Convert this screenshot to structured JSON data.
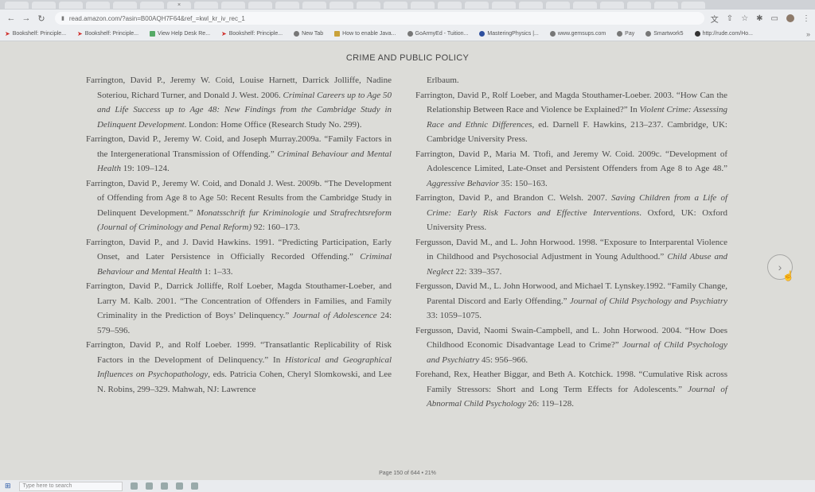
{
  "browser": {
    "tabs": [
      "",
      "",
      "",
      "",
      "",
      "",
      "",
      "",
      "",
      "",
      "",
      "",
      "",
      "",
      "",
      "",
      "",
      "",
      "",
      "",
      "",
      "",
      "",
      "",
      "",
      "",
      "",
      "",
      "",
      ""
    ],
    "close_tab_glyph": "×",
    "nav": {
      "back": "←",
      "forward": "→",
      "reload": "↻"
    },
    "url": "read.amazon.com/?asin=B00AQH7F64&ref_=kwl_kr_iv_rec_1",
    "right_icons": {
      "translate": "文",
      "share": "⇧",
      "star": "☆",
      "extensions": "✱",
      "sidepanel": "▭",
      "menu": "⋮"
    }
  },
  "bookmarks": [
    {
      "label": "Bookshelf: Principle..."
    },
    {
      "label": "Bookshelf: Principle..."
    },
    {
      "label": "View Help Desk Re..."
    },
    {
      "label": "Bookshelf: Principle..."
    },
    {
      "label": "New Tab"
    },
    {
      "label": "How to enable Java..."
    },
    {
      "label": "GoArmyEd - Tuition..."
    },
    {
      "label": "MasteringPhysics |..."
    },
    {
      "label": "www.gemsups.com"
    },
    {
      "label": "Pay"
    },
    {
      "label": "Smartwork5"
    },
    {
      "label": "http://rude.com/Ho..."
    }
  ],
  "bookmarks_more": "»",
  "book": {
    "running_header": "CRIME AND PUBLIC POLICY",
    "left_column": [
      {
        "a": "Farrington, David P., Jeremy W. Coid, Louise Harnett, Darrick Jolliffe, Nadine Soteriou, Richard Turner, and Donald J. West. 2006. ",
        "i": "Criminal Careers up to Age 50 and Life Success up to Age 48: New Findings from the Cambridge Study in Delinquent Development",
        "b": ". London: Home Office (Research Study No. 299)."
      },
      {
        "a": "Farrington, David P., Jeremy W. Coid, and Joseph Murray.2009a. “Family Factors in the Intergenerational Transmission of Offending.” ",
        "i": "Criminal Behaviour and Mental Health",
        "b": " 19: 109–124."
      },
      {
        "a": "Farrington, David P., Jeremy W. Coid, and Donald J. West. 2009b. “The Development of Offending from Age 8 to Age 50: Recent Results from the Cambridge Study in Delinquent Development.” ",
        "i": "Monatsschrift fur Kriminologie und Strafrechtsreform (Journal of Criminology and Penal Reform)",
        "b": " 92: 160–173."
      },
      {
        "a": "Farrington, David P., and J. David Hawkins. 1991. “Predicting Participation, Early Onset, and Later Persistence in Officially Recorded Offending.” ",
        "i": "Criminal Behaviour and Mental Health",
        "b": " 1: 1–33."
      },
      {
        "a": "Farrington, David P., Darrick Jolliffe, Rolf Loeber, Magda Stouthamer-Loeber, and Larry M. Kalb. 2001. “The Concentration of Offenders in Families, and Family Criminality in the Prediction of Boys’ Delinquency.” ",
        "i": "Journal of Adolescence",
        "b": " 24: 579–596."
      },
      {
        "a": "Farrington, David P., and Rolf Loeber. 1999. “Transatlantic Replicability of Risk Factors in the Development of Delinquency.” In ",
        "i": "Historical and Geographical Influences on Psychopathology",
        "b": ", eds. Patricia Cohen, Cheryl Slomkowski, and Lee N. Robins, 299–329. Mahwah, NJ: Lawrence"
      }
    ],
    "right_continuation": "Erlbaum.",
    "right_column": [
      {
        "a": "Farrington, David P., Rolf Loeber, and Magda Stouthamer-Loeber. 2003. “How Can the Relationship Between Race and Violence be Explained?” In ",
        "i": "Violent Crime: Assessing Race and Ethnic Differences",
        "b": ", ed. Darnell F. Hawkins, 213–237. Cambridge, UK: Cambridge University Press."
      },
      {
        "a": "Farrington, David P., Maria M. Ttofi, and Jeremy W. Coid. 2009c. “Development of Adolescence Limited, Late-Onset and Persistent Offenders from Age 8 to Age 48.” ",
        "i": "Aggressive Behavior",
        "b": " 35: 150–163."
      },
      {
        "a": "Farrington, David P., and Brandon C. Welsh. 2007. ",
        "i": "Saving Children from a Life of Crime: Early Risk Factors and Effective Interventions",
        "b": ". Oxford, UK: Oxford University Press."
      },
      {
        "a": "Fergusson, David M., and L. John Horwood. 1998. “Exposure to Interparental Violence in Childhood and Psychosocial Adjustment in Young Adulthood.” ",
        "i": "Child Abuse and Neglect",
        "b": " 22: 339–357."
      },
      {
        "a": "Fergusson, David M., L. John Horwood, and Michael T. Lynskey.1992. “Family Change, Parental Discord and Early Offending.” ",
        "i": "Journal of Child Psychology and Psychiatry",
        "b": " 33: 1059–1075."
      },
      {
        "a": "Fergusson, David, Naomi Swain-Campbell, and L. John Horwood. 2004. “How Does Childhood Economic Disadvantage Lead to Crime?” ",
        "i": "Journal of Child Psychology and Psychiatry",
        "b": " 45: 956–966."
      },
      {
        "a": "Forehand, Rex, Heather Biggar, and Beth A. Kotchick. 1998. “Cumulative Risk across Family Stressors: Short and Long Term Effects for Adolescents.” ",
        "i": "Journal of Abnormal Child Psychology",
        "b": " 26: 119–128."
      }
    ],
    "next_page_glyph": "›",
    "page_status": "Page 150 of 644 • 21%"
  },
  "taskbar": {
    "start_glyph": "⊞",
    "search_placeholder": "Type here to search"
  }
}
